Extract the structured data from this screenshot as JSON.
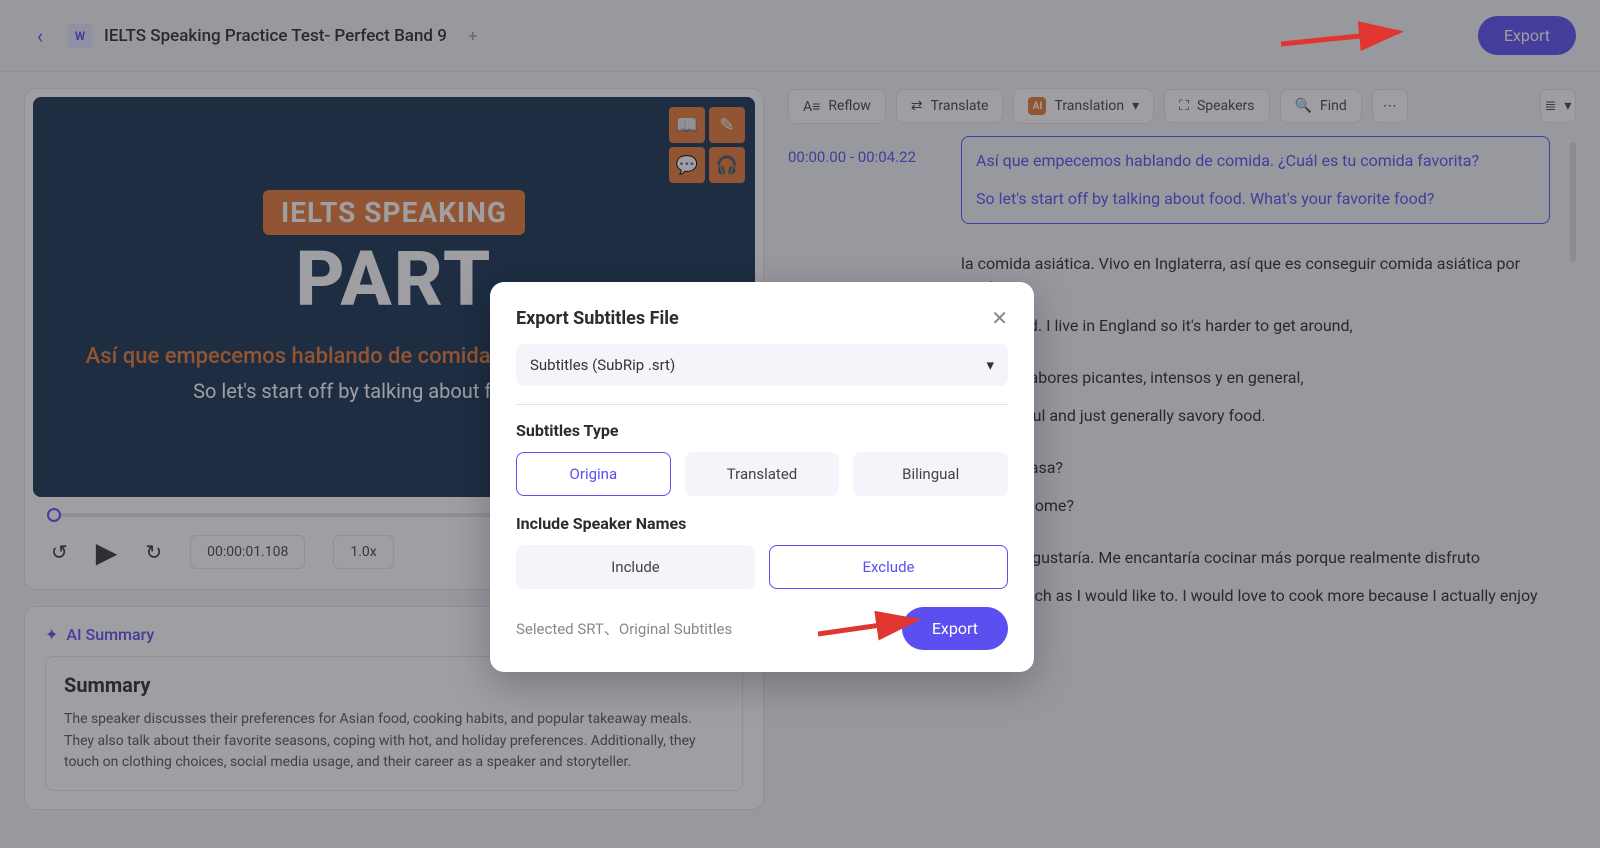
{
  "header": {
    "title": "IELTS Speaking Practice Test- Perfect Band 9",
    "export_label": "Export"
  },
  "video": {
    "pill": "IELTS SPEAKING",
    "part": "PART",
    "subtitle_es": "Así que empecemos hablando de comida. ¿Cuál es tu comida f",
    "subtitle_en": "So let's start off by talking about food. What's",
    "timecode": "00:00:01.108",
    "speed": "1.0x"
  },
  "summary": {
    "head": "AI Summary",
    "title": "Summary",
    "body": "The speaker discusses their preferences for Asian food, cooking habits, and popular takeaway meals. They also talk about their favorite seasons, coping with hot, and holiday preferences. Additionally, they touch on clothing choices, social media usage, and their career as a speaker and storyteller."
  },
  "toolbar": {
    "reflow": "Reflow",
    "translate": "Translate",
    "translation": "Translation",
    "speakers": "Speakers",
    "find": "Find"
  },
  "transcript": [
    {
      "time": "00:00.00 - 00:04.22",
      "es": "Así que empecemos hablando de comida. ¿Cuál es tu comida favorita?",
      "en": "So let's start off by talking about food. What's your favorite food?",
      "active": true
    },
    {
      "time": "",
      "es": "la comida asiática. Vivo en Inglaterra, así que es conseguir comida asiática por aquí,",
      "en": "Asian food. I live in England so it's harder to get around,",
      "active": false
    },
    {
      "time": "",
      "es": "stan los sabores picantes, intensos y en general,",
      "en": "icy, flavorful and just generally savory food.",
      "active": false
    },
    {
      "time": "",
      "es": "ucho en casa?",
      "en": "k a lot at home?",
      "active": false
    },
    {
      "time": "",
      "es": "como me gustaría. Me encantaría cocinar más porque realmente disfruto",
      "en": "Not as much as I would like to. I would love to cook more because I actually enjoy",
      "active": false
    }
  ],
  "modal": {
    "title": "Export Subtitles File",
    "format": "Subtitles (SubRip .srt)",
    "type_label": "Subtitles Type",
    "type_options": [
      "Origina",
      "Translated",
      "Bilingual"
    ],
    "type_selected_index": 0,
    "speaker_label": "Include Speaker Names",
    "speaker_options": [
      "Include",
      "Exclude"
    ],
    "speaker_selected_index": 1,
    "selected_summary": "Selected SRT、Original Subtitles",
    "export_label": "Export"
  }
}
